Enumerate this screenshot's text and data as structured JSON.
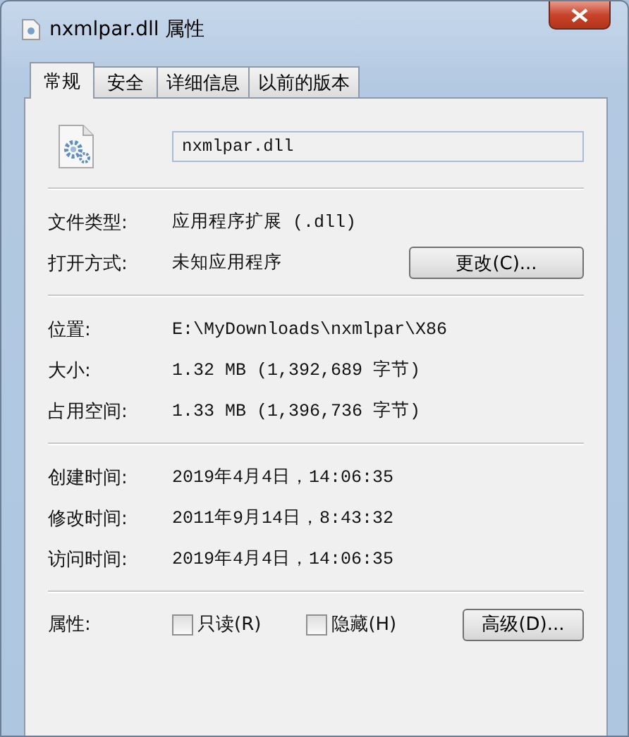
{
  "window": {
    "title": "nxmlpar.dll 属性"
  },
  "tabs": [
    {
      "label": "常规",
      "selected": true
    },
    {
      "label": "安全",
      "selected": false
    },
    {
      "label": "详细信息",
      "selected": false
    },
    {
      "label": "以前的版本",
      "selected": false
    }
  ],
  "file_name": {
    "value": "nxmlpar.dll"
  },
  "sections": [
    [
      {
        "label": "文件类型:",
        "value": "应用程序扩展 (.dll)"
      },
      {
        "label": "打开方式:",
        "value": "未知应用程序",
        "button": "更改(C)..."
      }
    ],
    [
      {
        "label": "位置:",
        "value": "E:\\MyDownloads\\nxmlpar\\X86"
      },
      {
        "label": "大小:",
        "value": "1.32 MB (1,392,689 字节)"
      },
      {
        "label": "占用空间:",
        "value": "1.33 MB (1,396,736 字节)"
      }
    ],
    [
      {
        "label": "创建时间:",
        "value": "2019年4月4日，14:06:35"
      },
      {
        "label": "修改时间:",
        "value": "2011年9月14日，8:43:32"
      },
      {
        "label": "访问时间:",
        "value": "2019年4月4日，14:06:35"
      }
    ]
  ],
  "attributes": {
    "label": "属性:",
    "checkboxes": [
      {
        "label": "只读(R)",
        "checked": false
      },
      {
        "label": "隐藏(H)",
        "checked": false
      }
    ],
    "button": "高级(D)..."
  }
}
